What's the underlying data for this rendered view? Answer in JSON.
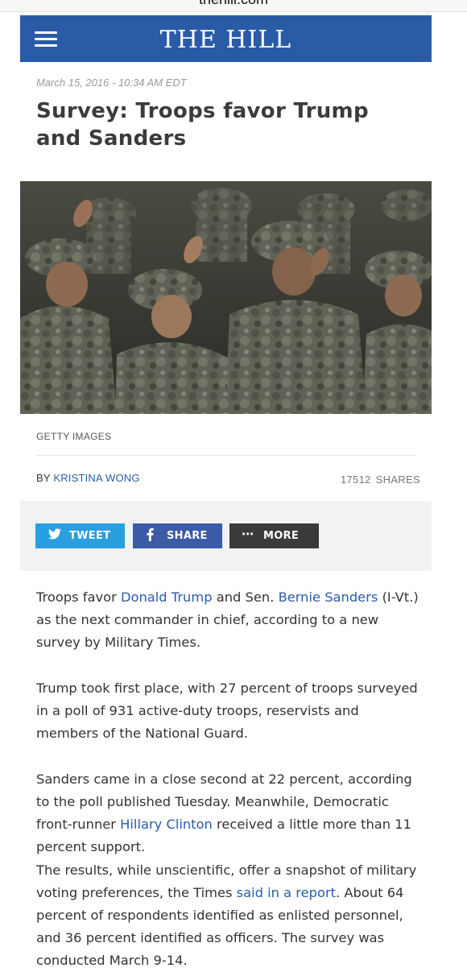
{
  "browser": {
    "url": "thehill.com"
  },
  "header": {
    "brand": "THE HILL",
    "menu_icon": "hamburger-menu-icon"
  },
  "article": {
    "dateline": "March 15, 2016 - 10:34 AM EDT",
    "headline_line1": "Survey: Troops favor Trump",
    "headline_line2": "and Sanders",
    "image_credit": "GETTY IMAGES",
    "byline_prefix": "BY",
    "author": "KRISTINA WONG",
    "share_count": "17512",
    "share_count_label": "SHARES"
  },
  "share_buttons": {
    "tweet": {
      "label": "TWEET",
      "icon": "twitter-bird-icon",
      "color": "#2a9fe0"
    },
    "share": {
      "label": "SHARE",
      "icon": "facebook-icon",
      "color": "#3b5ba6"
    },
    "more": {
      "label": "MORE",
      "icon": "ellipsis-icon",
      "color": "#3a3a3a"
    }
  },
  "body": {
    "p1": {
      "a": "Troops favor ",
      "link1": "Donald Trump",
      "b": " and Sen. ",
      "link2": "Bernie Sanders",
      "c": " (I-Vt.) as the next commander in chief, according to a new survey by Military Times."
    },
    "p2": "Trump took first place, with 27 percent of troops surveyed in a poll of 931 active-duty troops, reservists and members of the National Guard.",
    "p3": {
      "a": "Sanders came in a close second at 22 percent, according to the poll published Tuesday. Meanwhile, Democratic front-runner ",
      "link": "Hillary Clinton",
      "b": " received a little more than 11 percent support."
    },
    "p4": {
      "a": "The results, while unscientific, offer a snapshot of military voting preferences, the Times ",
      "link": "said in a report",
      "b": ". About 64 percent of respondents identified as enlisted personnel, and 36 percent identified as officers. The survey was conducted March 9-14."
    }
  },
  "colors": {
    "brand_blue": "#2a5ba7",
    "link": "#2a5ba7"
  }
}
